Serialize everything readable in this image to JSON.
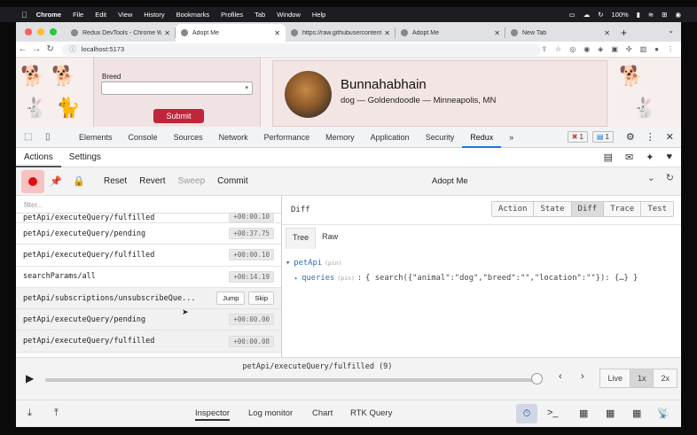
{
  "macos": {
    "menu": [
      "Chrome",
      "File",
      "Edit",
      "View",
      "History",
      "Bookmarks",
      "Profiles",
      "Tab",
      "Window",
      "Help"
    ],
    "battery": "100%",
    "status_icons": [
      "display-icon",
      "creative-cloud-icon",
      "sync-icon",
      "battery-icon",
      "wifi-icon",
      "control-center-icon",
      "screen-record-icon"
    ]
  },
  "browser": {
    "tabs": [
      {
        "title": "Redux DevTools - Chrome Web..."
      },
      {
        "title": "Adopt Me",
        "active": true
      },
      {
        "title": "https://raw.githubusercontent..."
      },
      {
        "title": "Adopt Me"
      },
      {
        "title": "New Tab"
      }
    ],
    "url": "localhost:5173",
    "new_tab": "+"
  },
  "page": {
    "form": {
      "breed_label": "Breed",
      "submit_label": "Submit"
    },
    "pet": {
      "name": "Bunnahabhain",
      "subtitle": "dog — Goldendoodle — Minneapolis, MN"
    }
  },
  "devtools": {
    "tabs": [
      "Elements",
      "Console",
      "Sources",
      "Network",
      "Performance",
      "Memory",
      "Application",
      "Security",
      "Redux"
    ],
    "active_tab": "Redux",
    "more": "»",
    "error_count": "1",
    "message_count": "1"
  },
  "redux": {
    "top_tabs": [
      "Actions",
      "Settings"
    ],
    "toolbar": {
      "reset": "Reset",
      "revert": "Revert",
      "sweep": "Sweep",
      "commit": "Commit",
      "instance": "Adopt Me"
    },
    "filter_placeholder": "filter...",
    "actions": [
      {
        "name": "petApi/executeQuery/fulfilled",
        "time": "+00:00.10"
      },
      {
        "name": "petApi/executeQuery/pending",
        "time": "+00:37.75"
      },
      {
        "name": "petApi/executeQuery/fulfilled",
        "time": "+00:00.10"
      },
      {
        "name": "searchParams/all",
        "time": "+00:14.19"
      },
      {
        "name": "petApi/subscriptions/unsubscribeQue...",
        "jump": "Jump",
        "skip": "Skip"
      },
      {
        "name": "petApi/executeQuery/pending",
        "time": "+00:00.00"
      },
      {
        "name": "petApi/executeQuery/fulfilled",
        "time": "+00:00.08"
      }
    ],
    "diff": {
      "title": "Diff",
      "seg": [
        "Action",
        "State",
        "Diff",
        "Trace",
        "Test"
      ],
      "active_seg": "Diff",
      "subtabs": [
        "Tree",
        "Raw"
      ],
      "active_sub": "Tree",
      "tree": {
        "root": "petApi",
        "pin": "(pin)",
        "child_key": "queries",
        "child_value": "{ search({\"animal\":\"dog\",\"breed\":\"\",\"location\":\"\"}): {…} }"
      }
    },
    "slider": {
      "caption": "petApi/executeQuery/fulfilled (9)",
      "position": 0.99,
      "live": "Live",
      "speeds": [
        "1x",
        "2x"
      ],
      "active_speed": "1x"
    },
    "bottom": {
      "tabs": [
        "Inspector",
        "Log monitor",
        "Chart",
        "RTK Query"
      ],
      "active": "Inspector"
    }
  }
}
